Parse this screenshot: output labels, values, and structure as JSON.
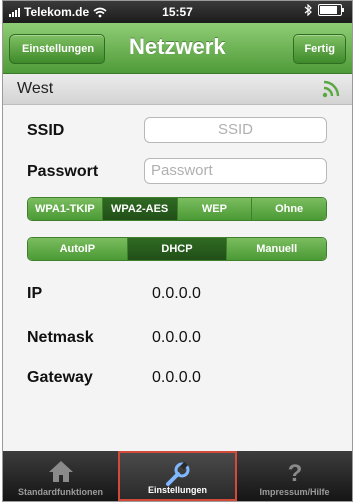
{
  "status_bar": {
    "carrier": "Telekom.de",
    "time": "15:57"
  },
  "nav": {
    "back_label": "Einstellungen",
    "title": "Netzwerk",
    "done_label": "Fertig"
  },
  "section": {
    "title": "West"
  },
  "fields": {
    "ssid_label": "SSID",
    "ssid_placeholder": "SSID",
    "password_label": "Passwort",
    "password_placeholder": "Passwort"
  },
  "security": {
    "options": [
      "WPA1-TKIP",
      "WPA2-AES",
      "WEP",
      "Ohne"
    ],
    "selected": "WPA2-AES"
  },
  "addressing": {
    "options": [
      "AutoIP",
      "DHCP",
      "Manuell"
    ],
    "selected": "DHCP"
  },
  "network_info": {
    "ip_label": "IP",
    "ip_value": "0.0.0.0",
    "netmask_label": "Netmask",
    "netmask_value": "0.0.0.0",
    "gateway_label": "Gateway",
    "gateway_value": "0.0.0.0"
  },
  "tabs": [
    {
      "label": "Standardfunktionen",
      "icon": "home-icon"
    },
    {
      "label": "Einstellungen",
      "icon": "wrench-icon",
      "active": true
    },
    {
      "label": "Impressum/Hilfe",
      "icon": "question-icon"
    }
  ],
  "colors": {
    "accent": "#5aa842",
    "selected_segment": "#2a5e1f",
    "active_tab_border": "#d24a3a"
  }
}
